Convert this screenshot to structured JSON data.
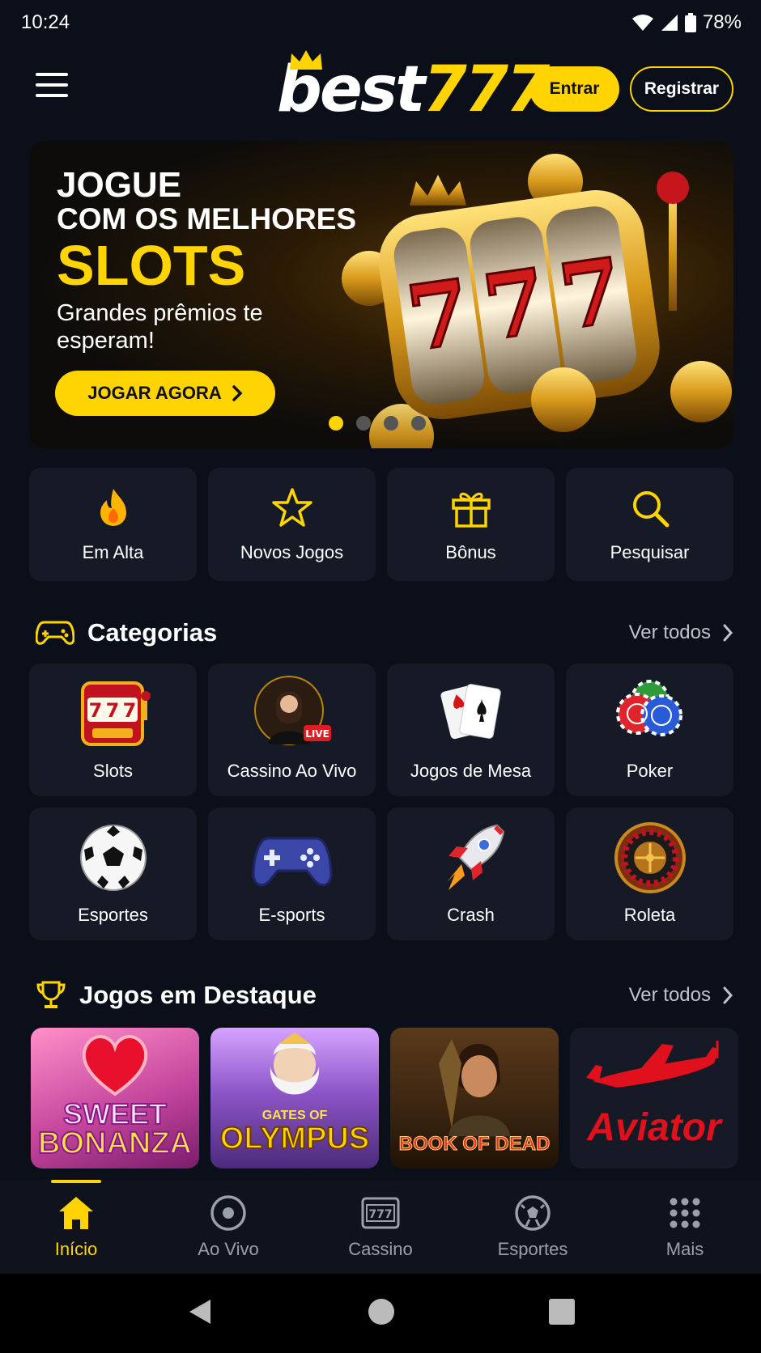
{
  "status_bar": {
    "time": "10:24",
    "battery": "78%"
  },
  "header": {
    "logo_white": "best",
    "logo_yellow": "777",
    "login_label": "Entrar",
    "register_label": "Registrar"
  },
  "banner": {
    "line1": "JOGUE",
    "line2": "COM OS MELHORES",
    "line3": "SLOTS",
    "subtitle": "Grandes prêmios te esperam!",
    "cta": "JOGAR AGORA",
    "reel_symbols": [
      "7",
      "7",
      "7"
    ],
    "slides_total": 4,
    "active_slide": 1
  },
  "quick_actions": [
    {
      "label": "Em Alta",
      "icon": "fire-icon"
    },
    {
      "label": "Novos Jogos",
      "icon": "star-icon"
    },
    {
      "label": "Bônus",
      "icon": "gift-icon"
    },
    {
      "label": "Pesquisar",
      "icon": "search-icon"
    }
  ],
  "categories_section": {
    "title": "Categorias",
    "see_all": "Ver todos",
    "items": [
      {
        "label": "Slots",
        "icon": "slot-machine-icon"
      },
      {
        "label": "Cassino Ao Vivo",
        "icon": "live-dealer-icon",
        "badge": "LIVE"
      },
      {
        "label": "Jogos de Mesa",
        "icon": "playing-cards-icon"
      },
      {
        "label": "Poker",
        "icon": "poker-chips-icon"
      },
      {
        "label": "Esportes",
        "icon": "soccer-ball-icon"
      },
      {
        "label": "E-sports",
        "icon": "gamepad-icon"
      },
      {
        "label": "Crash",
        "icon": "rocket-icon"
      },
      {
        "label": "Roleta",
        "icon": "roulette-icon"
      }
    ]
  },
  "featured_section": {
    "title": "Jogos em Destaque",
    "see_all": "Ver todos",
    "games": [
      {
        "name_line1": "SWEET",
        "name_line2": "BONANZA"
      },
      {
        "name_line1": "GATES OF",
        "name_line2": "OLYMPUS"
      },
      {
        "name_line1": "BOOK OF DEAD",
        "name_line2": ""
      },
      {
        "name_line1": "Aviator",
        "name_line2": ""
      }
    ]
  },
  "bottom_nav": [
    {
      "label": "Início",
      "icon": "home-icon",
      "active": true
    },
    {
      "label": "Ao Vivo",
      "icon": "live-icon",
      "active": false
    },
    {
      "label": "Cassino",
      "icon": "casino-icon",
      "active": false
    },
    {
      "label": "Esportes",
      "icon": "sports-ball-icon",
      "active": false
    },
    {
      "label": "Mais",
      "icon": "grid-icon",
      "active": false
    }
  ],
  "colors": {
    "accent": "#ffd400",
    "background": "#0b0f19",
    "card": "#151a26"
  }
}
